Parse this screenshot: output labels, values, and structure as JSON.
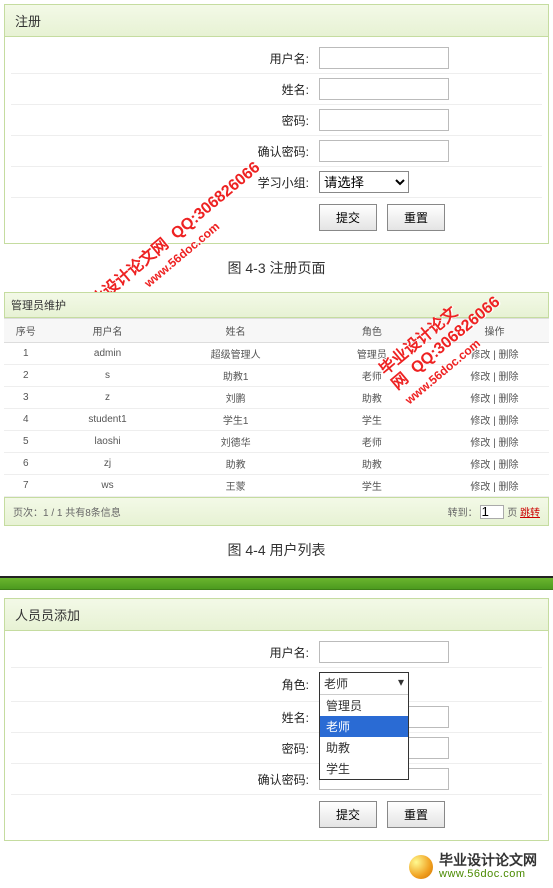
{
  "register": {
    "title": "注册",
    "labels": {
      "username": "用户名:",
      "name": "姓名:",
      "password": "密码:",
      "confirm": "确认密码:",
      "group": "学习小组:"
    },
    "group_placeholder": "请选择",
    "submit": "提交",
    "reset": "重置",
    "caption": "图 4-3 注册页面"
  },
  "userlist": {
    "title": "管理员维护",
    "cols": {
      "seq": "序号",
      "username": "用户名",
      "name": "姓名",
      "role": "角色",
      "ops": "操作"
    },
    "rows": [
      {
        "seq": "1",
        "username": "admin",
        "name": "超级管理人",
        "role": "管理员",
        "ops": "修改 | 删除"
      },
      {
        "seq": "2",
        "username": "s",
        "name": "助教1",
        "role": "老师",
        "ops": "修改 | 删除"
      },
      {
        "seq": "3",
        "username": "z",
        "name": "刘鹏",
        "role": "助教",
        "ops": "修改 | 删除"
      },
      {
        "seq": "4",
        "username": "student1",
        "name": "学生1",
        "role": "学生",
        "ops": "修改 | 删除"
      },
      {
        "seq": "5",
        "username": "laoshi",
        "name": "刘德华",
        "role": "老师",
        "ops": "修改 | 删除"
      },
      {
        "seq": "6",
        "username": "zj",
        "name": "助教",
        "role": "助教",
        "ops": "修改 | 删除"
      },
      {
        "seq": "7",
        "username": "ws",
        "name": "王蒙",
        "role": "学生",
        "ops": "修改 | 删除"
      }
    ],
    "pager_left": "页次：1 / 1 共有8条信息",
    "pager_goto": "转到：",
    "pager_page": "页",
    "pager_jump": "跳转",
    "caption": "图 4-4 用户列表"
  },
  "addperson": {
    "title": "人员员添加",
    "labels": {
      "username": "用户名:",
      "role": "角色:",
      "name": "姓名:",
      "password": "密码:",
      "confirm": "确认密码:"
    },
    "role_selected": "老师",
    "role_options": [
      "管理员",
      "老师",
      "助教",
      "学生"
    ],
    "submit": "提交",
    "reset": "重置"
  },
  "watermark": {
    "main": "毕业设计论文网",
    "qq": "QQ:306826066",
    "url": "www.56doc.com"
  },
  "footer": {
    "t1": "毕业设计论文网",
    "t2": "www.56doc.com"
  }
}
